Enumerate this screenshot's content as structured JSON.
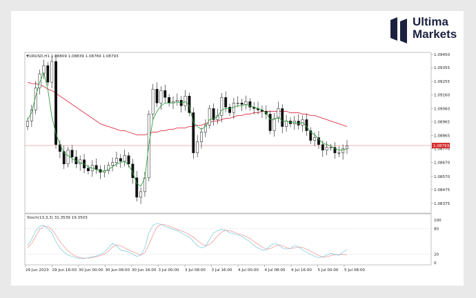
{
  "brand": {
    "line1": "Ultima",
    "line2": "Markets",
    "color": "#1b2240"
  },
  "chart_data": {
    "type": "candlestick",
    "symbol_header": "EURUSD,H1  1.08809 1.08839 1.08769 1.08793",
    "price_ylim": [
      1.0832,
      1.0945
    ],
    "price_ticks": [
      "1.09450",
      "1.09355",
      "1.09255",
      "1.09160",
      "1.09060",
      "1.08965",
      "1.08865",
      "1.08770",
      "1.08670",
      "1.08570",
      "1.08475",
      "1.08375"
    ],
    "current_price": "1.08793",
    "current_price_value": 1.08793,
    "x_ticks": [
      "29 Jun 2023",
      "29 Jun 16:00",
      "30 Jun 00:00",
      "30 Jun 08:00",
      "30 Jun 16:00",
      "3 Jul 00:00",
      "3 Jul 08:00",
      "3 Jul 16:00",
      "4 Jul 00:00",
      "4 Jul 08:00",
      "4 Jul 16:00",
      "5 Jul 00:00",
      "5 Jul 08:00"
    ],
    "close": [
      1.0897,
      1.0905,
      1.0921,
      1.0931,
      1.0937,
      1.0925,
      1.094,
      1.088,
      1.0875,
      1.0866,
      1.0876,
      1.0871,
      1.0866,
      1.0869,
      1.0863,
      1.0861,
      1.0865,
      1.0862,
      1.086,
      1.0861,
      1.0865,
      1.0867,
      1.087,
      1.0868,
      1.0872,
      1.0866,
      1.0856,
      1.0842,
      1.0846,
      1.0856,
      1.0902,
      1.092,
      1.091,
      1.0919,
      1.0914,
      1.091,
      1.0911,
      1.0912,
      1.0908,
      1.0915,
      1.0903,
      1.0874,
      1.0882,
      1.0889,
      1.0894,
      1.0906,
      1.0898,
      1.0901,
      1.0914,
      1.0907,
      1.0903,
      1.091,
      1.091,
      1.0909,
      1.0911,
      1.0907,
      1.0906,
      1.0905,
      1.0904,
      1.0902,
      1.089,
      1.0899,
      1.0906,
      1.0893,
      1.0897,
      1.0895,
      1.0897,
      1.0894,
      1.0898,
      1.089,
      1.0883,
      1.0885,
      1.088,
      1.0876,
      1.0878,
      1.0878,
      1.0874,
      1.0874,
      1.0877,
      1.0879
    ],
    "ema_fast": [
      1.0898,
      1.0903,
      1.0915,
      1.0925,
      1.0932,
      1.092,
      1.09,
      1.0888,
      1.088,
      1.0874,
      1.0872,
      1.087,
      1.0868,
      1.0867,
      1.0866,
      1.0864,
      1.0863,
      1.0862,
      1.0861,
      1.0861,
      1.0862,
      1.0864,
      1.0866,
      1.0867,
      1.0868,
      1.0865,
      1.086,
      1.0852,
      1.085,
      1.0856,
      1.088,
      1.0898,
      1.0904,
      1.0908,
      1.091,
      1.091,
      1.091,
      1.0911,
      1.091,
      1.0911,
      1.0908,
      1.0896,
      1.0893,
      1.0891,
      1.0893,
      1.0898,
      1.0899,
      1.09,
      1.0905,
      1.0906,
      1.0906,
      1.0907,
      1.0908,
      1.0908,
      1.0909,
      1.0908,
      1.0907,
      1.0906,
      1.0905,
      1.0903,
      1.0898,
      1.0898,
      1.09,
      1.0897,
      1.0897,
      1.0896,
      1.0896,
      1.0895,
      1.0896,
      1.0893,
      1.0889,
      1.0887,
      1.0884,
      1.0881,
      1.088,
      1.0879,
      1.0877,
      1.0876,
      1.0876,
      1.0877
    ],
    "ma_slow": [
      1.0925,
      1.0924,
      1.0924,
      1.0923,
      1.0922,
      1.092,
      1.0919,
      1.0917,
      1.0915,
      1.0913,
      1.0911,
      1.0909,
      1.0907,
      1.0905,
      1.0903,
      1.0901,
      1.0899,
      1.0897,
      1.0895,
      1.0894,
      1.0893,
      1.0892,
      1.0891,
      1.089,
      1.089,
      1.0889,
      1.0888,
      1.0887,
      1.0887,
      1.0887,
      1.0888,
      1.0889,
      1.0889,
      1.089,
      1.089,
      1.0891,
      1.0891,
      1.0892,
      1.0892,
      1.0892,
      1.0893,
      1.0893,
      1.0894,
      1.0894,
      1.0895,
      1.0896,
      1.0897,
      1.0897,
      1.0898,
      1.0899,
      1.0899,
      1.09,
      1.0901,
      1.0901,
      1.0902,
      1.0902,
      1.0903,
      1.0903,
      1.0904,
      1.0904,
      1.0904,
      1.0904,
      1.0904,
      1.0904,
      1.0904,
      1.0903,
      1.0903,
      1.0903,
      1.0902,
      1.0902,
      1.0901,
      1.0901,
      1.09,
      1.0899,
      1.0898,
      1.0897,
      1.0896,
      1.0895,
      1.0894,
      1.0893
    ],
    "stoch_header": "Stoch(13,3,3) 31.3539 19.3503",
    "stoch_ticks": [
      "100",
      "80",
      "20",
      "0"
    ],
    "stoch_levels": [
      80,
      20
    ],
    "stoch_k": [
      40,
      55,
      75,
      85,
      88,
      80,
      70,
      50,
      35,
      25,
      18,
      15,
      12,
      10,
      10,
      12,
      14,
      16,
      20,
      25,
      35,
      45,
      40,
      30,
      28,
      25,
      20,
      15,
      18,
      35,
      70,
      88,
      92,
      90,
      85,
      82,
      78,
      75,
      70,
      65,
      60,
      50,
      40,
      35,
      38,
      55,
      70,
      75,
      78,
      76,
      70,
      68,
      65,
      62,
      55,
      50,
      40,
      35,
      30,
      30,
      40,
      45,
      42,
      35,
      32,
      34,
      40,
      38,
      30,
      25,
      20,
      15,
      12,
      14,
      18,
      22,
      20,
      18,
      25,
      31
    ],
    "stoch_d": [
      35,
      45,
      62,
      78,
      85,
      85,
      78,
      65,
      50,
      38,
      28,
      20,
      15,
      12,
      11,
      11,
      12,
      14,
      17,
      20,
      27,
      37,
      42,
      40,
      35,
      30,
      26,
      22,
      18,
      24,
      42,
      65,
      84,
      90,
      89,
      86,
      82,
      78,
      75,
      71,
      66,
      60,
      52,
      45,
      40,
      43,
      52,
      63,
      72,
      76,
      75,
      72,
      68,
      65,
      62,
      57,
      50,
      43,
      37,
      32,
      33,
      38,
      42,
      40,
      36,
      33,
      35,
      37,
      36,
      32,
      27,
      22,
      17,
      13,
      14,
      17,
      19,
      19,
      20,
      19
    ]
  },
  "colors": {
    "bull": "#ffffff",
    "bear": "#111111",
    "ema_fast": "#2e9e3e",
    "ma_slow": "#e0304a",
    "k_line": "#6fc7d6",
    "d_line": "#f08a8a",
    "price_tag": "#d62d2d"
  }
}
